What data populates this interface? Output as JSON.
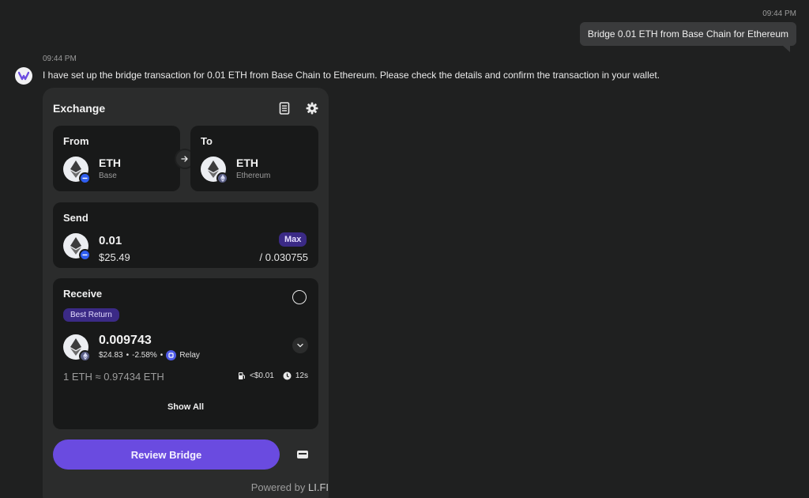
{
  "user_message": {
    "time": "09:44 PM",
    "text": "Bridge 0.01 ETH from Base Chain for Ethereum"
  },
  "bot_message": {
    "time": "09:44 PM",
    "text": "I have set up the bridge transaction for 0.01 ETH from Base Chain to Ethereum. Please check the details and confirm the transaction in your wallet."
  },
  "widget": {
    "title": "Exchange",
    "icons": [
      "receipt-icon",
      "gear-icon"
    ],
    "from": {
      "label": "From",
      "token": "ETH",
      "chain": "Base"
    },
    "to": {
      "label": "To",
      "token": "ETH",
      "chain": "Ethereum"
    },
    "send": {
      "label": "Send",
      "amount": "0.01",
      "usd": "$25.49",
      "max_label": "Max",
      "balance": "/ 0.030755"
    },
    "receive": {
      "label": "Receive",
      "badge": "Best Return",
      "amount": "0.009743",
      "usd": "$24.83",
      "sep1": "•",
      "change": "-2.58%",
      "sep2": "•",
      "provider": "Relay",
      "rate": "1 ETH ≈ 0.97434 ETH",
      "gas": "<$0.01",
      "time": "12s"
    },
    "show_all": "Show All",
    "review_button": "Review Bridge",
    "powered_prefix": "Powered by",
    "powered_brand": "LI.FI"
  },
  "colors": {
    "accent": "#6a4be0",
    "pill": "#3b2a86",
    "card": "#181919",
    "panel": "#2b2c2c",
    "bg": "#1f2020"
  }
}
